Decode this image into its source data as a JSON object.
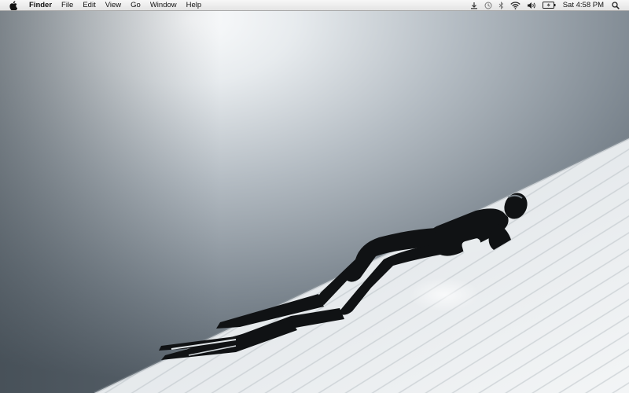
{
  "menubar": {
    "apple_icon": "apple-icon",
    "app_name": "Finder",
    "menus": [
      "File",
      "Edit",
      "View",
      "Go",
      "Window",
      "Help"
    ],
    "status_icons": [
      "time-machine-sync-icon",
      "clock-icon",
      "bluetooth-icon",
      "wifi-icon",
      "volume-icon",
      "battery-icon"
    ],
    "clock": "Sat 4:58 PM",
    "spotlight_icon": "spotlight-search-icon"
  },
  "desktop": {
    "wallpaper": "freediver-underwater-wallpaper",
    "colors": {
      "water_light": "#f4f6f8",
      "water_mid": "#a3adb6",
      "water_dark": "#5e6870",
      "sand": "#e6eaec",
      "diver": "#111111"
    }
  }
}
